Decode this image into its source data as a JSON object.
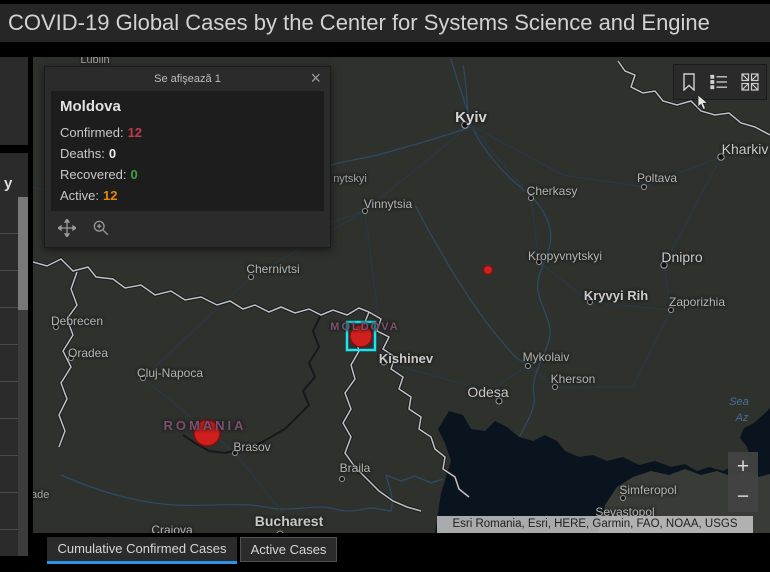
{
  "header": {
    "title": "COVID-19 Global Cases by the Center for Systems Science and Engine"
  },
  "sidebar": {
    "partial_heading": "y"
  },
  "popup": {
    "header": "Se afişează 1",
    "close_glyph": "×",
    "title": "Moldova",
    "fields": [
      {
        "label": "Confirmed:",
        "value": "12",
        "color": "#c23b4c"
      },
      {
        "label": "Deaths:",
        "value": "0",
        "color": "#ececec"
      },
      {
        "label": "Recovered:",
        "value": "0",
        "color": "#3fa23f"
      },
      {
        "label": "Active:",
        "value": "12",
        "color": "#e5860f"
      }
    ]
  },
  "map": {
    "labels": [
      {
        "text": "Lublin"
      },
      {
        "text": "nytskyi"
      },
      {
        "text": "Kyiv"
      },
      {
        "text": "Kharkiv"
      },
      {
        "text": "Poltava"
      },
      {
        "text": "Cherkasy"
      },
      {
        "text": "Vinnytsia"
      },
      {
        "text": "Kropyvnytskyi"
      },
      {
        "text": "Dnipro"
      },
      {
        "text": "Kryvyi Rih"
      },
      {
        "text": "Zaporizhia"
      },
      {
        "text": "Mykolaiv"
      },
      {
        "text": "Kherson"
      },
      {
        "text": "Odesa"
      },
      {
        "text": "Chernivtsi"
      },
      {
        "text": "Debrecen"
      },
      {
        "text": "Oradea"
      },
      {
        "text": "Cluj-Napoca"
      },
      {
        "text": "ROMANIA"
      },
      {
        "text": "MOLDOVA"
      },
      {
        "text": "Brasov"
      },
      {
        "text": "Bucharest"
      },
      {
        "text": "Braila"
      },
      {
        "text": "Craiova"
      },
      {
        "text": "Simferopol"
      },
      {
        "text": "Sevastopol"
      },
      {
        "text": "Kishinev"
      },
      {
        "text": "Sea"
      },
      {
        "text": "Az"
      },
      {
        "text": "ade"
      }
    ],
    "markers": {
      "selected_country": "Moldova",
      "selection_color": "#17e6f2",
      "case_color": "#d01f1f"
    }
  },
  "attribution": {
    "text": "Esri Romania, Esri, HERE, Garmin, FAO, NOAA, USGS"
  },
  "controls": {
    "zoom_in": "+",
    "zoom_out": "−"
  },
  "tabs": [
    {
      "label": "Cumulative Confirmed Cases",
      "active": true
    },
    {
      "label": "Active Cases",
      "active": false
    }
  ],
  "colors": {
    "accent_tab_underline": "#2e93e6",
    "confirmed_red": "#c23b4c",
    "recovered_green": "#3fa23f",
    "active_orange": "#e5860f",
    "titlebar_bg": "#262626",
    "map_bg": "#2f312d",
    "water": "#0a141f"
  }
}
